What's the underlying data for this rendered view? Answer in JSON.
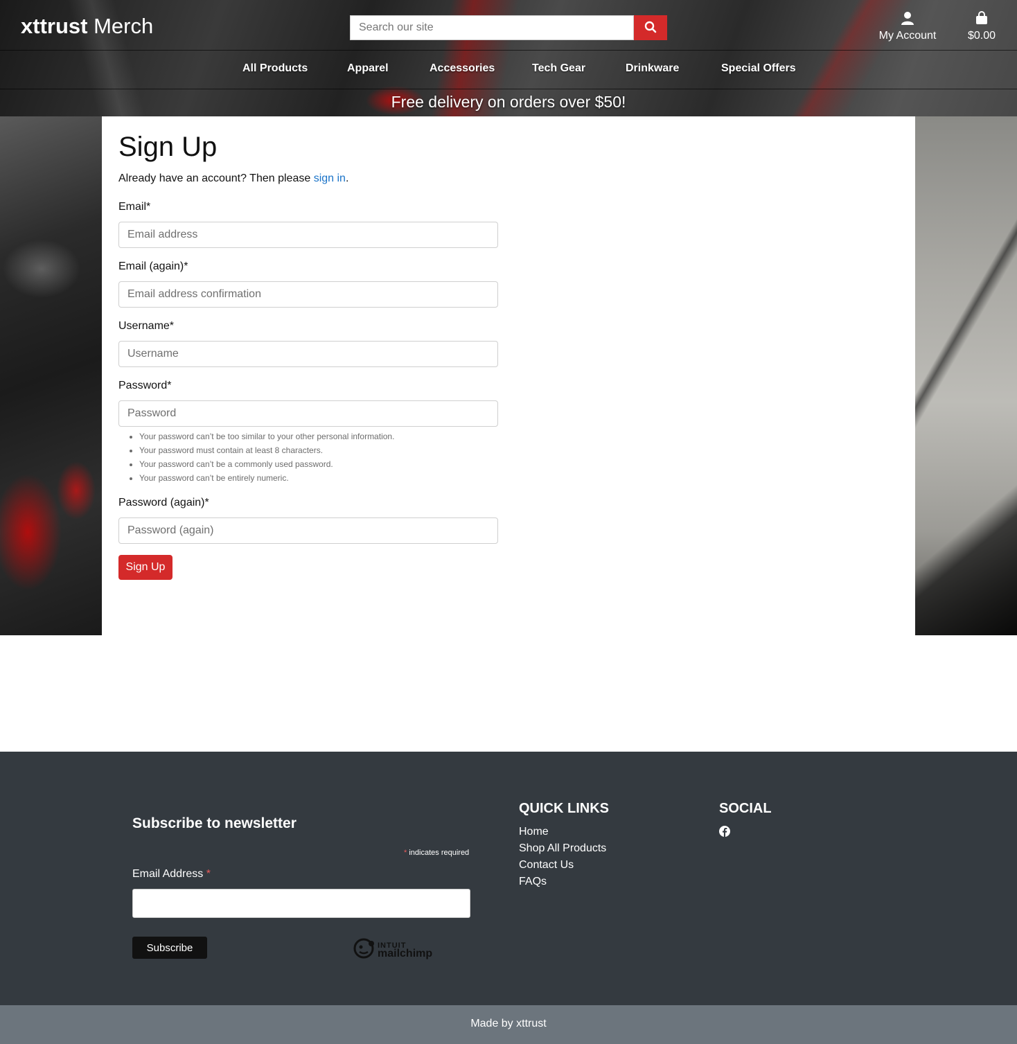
{
  "header": {
    "brand_bold": "xttrust",
    "brand_rest": "Merch",
    "search_placeholder": "Search our site",
    "account_label": "My Account",
    "cart_total": "$0.00"
  },
  "nav": {
    "items": [
      "All Products",
      "Apparel",
      "Accessories",
      "Tech Gear",
      "Drinkware",
      "Special Offers"
    ]
  },
  "promo": "Free delivery on orders over $50!",
  "form": {
    "title": "Sign Up",
    "intro_prefix": "Already have an account? Then please ",
    "intro_link": "sign in",
    "intro_suffix": ".",
    "email_label": "Email*",
    "email_placeholder": "Email address",
    "email2_label": "Email (again)*",
    "email2_placeholder": "Email address confirmation",
    "username_label": "Username*",
    "username_placeholder": "Username",
    "password_label": "Password*",
    "password_placeholder": "Password",
    "password_help": [
      "Your password can’t be too similar to your other personal information.",
      "Your password must contain at least 8 characters.",
      "Your password can’t be a commonly used password.",
      "Your password can’t be entirely numeric."
    ],
    "password2_label": "Password (again)*",
    "password2_placeholder": "Password (again)",
    "submit_label": "Sign Up"
  },
  "footer": {
    "newsletter_title": "Subscribe to newsletter",
    "required_note": "indicates required",
    "email_label": "Email Address",
    "subscribe_label": "Subscribe",
    "mailchimp_line1": "INTUIT",
    "mailchimp_line2": "mailchimp",
    "quick_links_title": "QUICK LINKS",
    "quick_links": [
      "Home",
      "Shop All Products",
      "Contact Us",
      "FAQs"
    ],
    "social_title": "SOCIAL",
    "credit": "Made by xttrust"
  },
  "colors": {
    "accent_red": "#d42a2a",
    "link_blue": "#1a73c8",
    "footer_dark": "#343a40",
    "footer_bottom": "#6c757d"
  },
  "icons": [
    "search-icon",
    "user-icon",
    "shopping-bag-icon",
    "facebook-icon",
    "mailchimp-logo"
  ]
}
